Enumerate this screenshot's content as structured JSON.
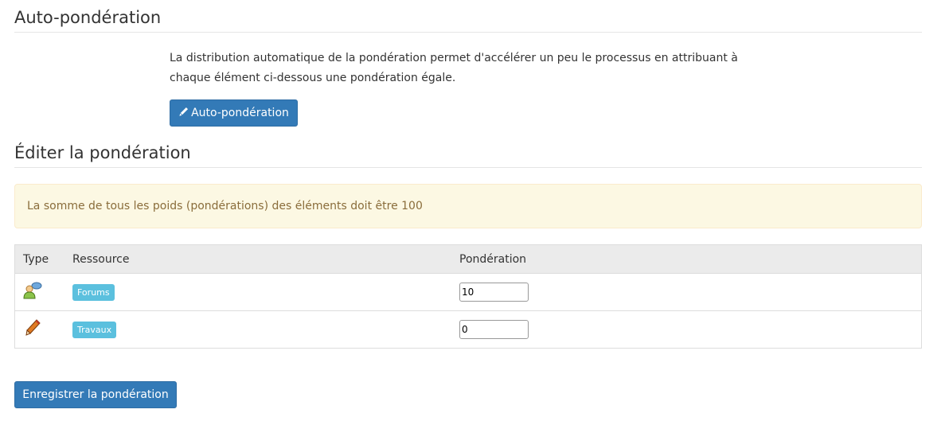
{
  "sections": {
    "auto_title": "Auto-pondération",
    "auto_description": "La distribution automatique de la pondération permet d'accélérer un peu le processus en attribuant à chaque élément ci-dessous une pondération égale.",
    "auto_button_label": "Auto-pondération",
    "auto_button_icon": "pencil-icon",
    "edit_title": "Éditer la pondération",
    "warning_text": "La somme de tous les poids (pondérations) des éléments doit être 100"
  },
  "table": {
    "headers": {
      "type": "Type",
      "resource": "Ressource",
      "weight": "Pondération"
    },
    "rows": [
      {
        "type_icon": "forum-users-icon",
        "resource": "Forums",
        "weight": "10"
      },
      {
        "type_icon": "pencil-icon",
        "resource": "Travaux",
        "weight": "0"
      }
    ]
  },
  "save_button_label": "Enregistrer la pondération",
  "colors": {
    "primary": "#337ab7",
    "label_info": "#5bc0de",
    "warning_bg": "#fcf8e3",
    "warning_text": "#8a6d3b"
  }
}
